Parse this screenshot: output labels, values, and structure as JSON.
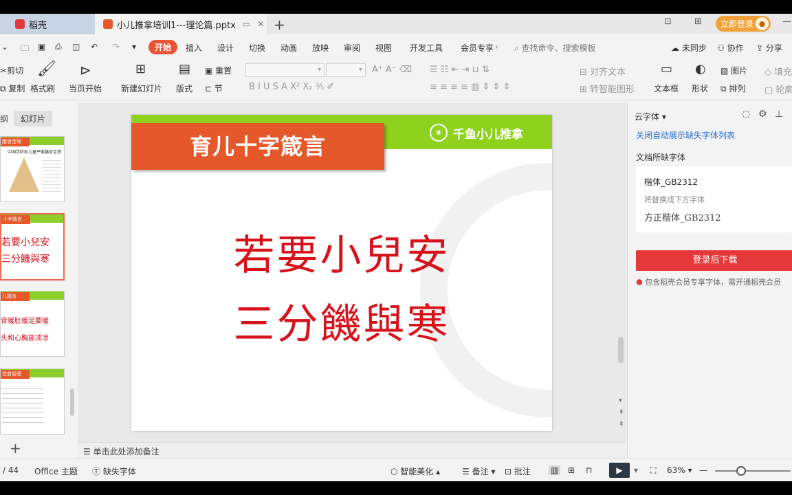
{
  "titlebar": {
    "home_tab": "稻壳",
    "doc_tab": "小儿推拿培训1---理论篇.pptx",
    "login": "立即登录"
  },
  "menu": {
    "items": [
      "开始",
      "插入",
      "设计",
      "切换",
      "动画",
      "放映",
      "审阅",
      "视图",
      "开发工具",
      "会员专享"
    ],
    "search_placeholder": "查找命令、搜索模板",
    "sync": "未同步",
    "collab": "协作",
    "share": "分享"
  },
  "ribbon": {
    "cut": "剪切",
    "copy": "复制",
    "format_painter": "格式刷",
    "from_current": "当页开始",
    "new_slide": "新建幻灯片",
    "layout": "版式",
    "section": "节",
    "reset": "重置",
    "align_text": "对齐文本",
    "smart_shape": "转智能图形",
    "textbox": "文本框",
    "shape": "形状",
    "arrange": "排列",
    "picture": "图片",
    "fill": "填充",
    "outline": "轮廓"
  },
  "left_panel": {
    "tab_outline": "纲",
    "tab_slides": "幻灯片",
    "thumbs": [
      {
        "head": "膳食宝塔",
        "caption": "中国学龄前儿童平衡膳食宝塔"
      },
      {
        "head": "十字箴言",
        "line1": "若要小兒安",
        "line2": "三分饑與寒"
      },
      {
        "head": "儿箴言",
        "line1": "背暖肚暖足要暖",
        "line2": "头和心胸部须凉"
      },
      {
        "head": "饮食俗语",
        "caption": ""
      }
    ]
  },
  "slide": {
    "title": "育儿十字箴言",
    "logo": "千鱼小儿推拿",
    "line1": "若要小兒安",
    "line2": "三分饑與寒"
  },
  "notes": "单击此处添加备注",
  "right_panel": {
    "header": "云字体",
    "close_link": "关闭自动展示缺失字体列表",
    "missing_label": "文档所缺字体",
    "missing_font": "楷体_GB2312",
    "replace_hint": "将替换成下方字体",
    "replacement_font": "方正楷体_GB2312",
    "download_button": "登录后下载",
    "member_note": "包含稻壳会员专享字体，需开通稻壳会员"
  },
  "status": {
    "page": "/ 44",
    "theme": "Office 主题",
    "missing_font": "缺失字体",
    "beautify": "智能美化",
    "notes": "备注",
    "comments": "批注",
    "zoom": "63%"
  }
}
